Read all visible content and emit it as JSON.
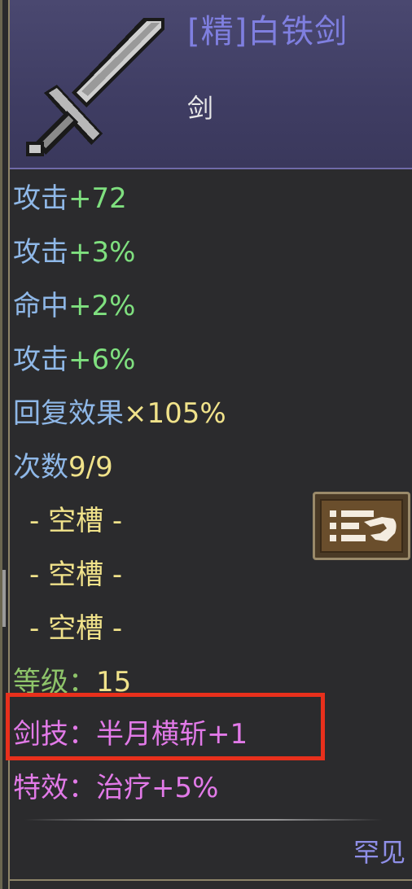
{
  "item": {
    "name": "[精]白铁剑",
    "type": "剑",
    "rarity": "罕见"
  },
  "stats": [
    {
      "label": "攻击",
      "value": "+72"
    },
    {
      "label": "攻击",
      "value": "+3%"
    },
    {
      "label": "命中",
      "value": "+2%"
    },
    {
      "label": "攻击",
      "value": "+6%"
    },
    {
      "label": "回复效果",
      "value": "×105%"
    },
    {
      "label": "次数",
      "value": "9/9"
    }
  ],
  "slots": [
    "- 空槽 -",
    "- 空槽 -",
    "- 空槽 -"
  ],
  "level": {
    "label": "等级：",
    "value": "15"
  },
  "skill": {
    "label": "剑技：",
    "value": "半月横斩+1"
  },
  "effect": {
    "label": "特效：",
    "value": "治疗+5%"
  },
  "icons": {
    "item": "sword-icon",
    "swap": "swap-equipment-icon"
  },
  "colors": {
    "header_bg": "#3f3d63",
    "name": "#7f7fe0",
    "stat_label": "#8fb8e8",
    "stat_value": "#7fe07f",
    "special": "#f0e28a",
    "magic": "#e27ae8",
    "highlight_box": "#e8301c"
  }
}
